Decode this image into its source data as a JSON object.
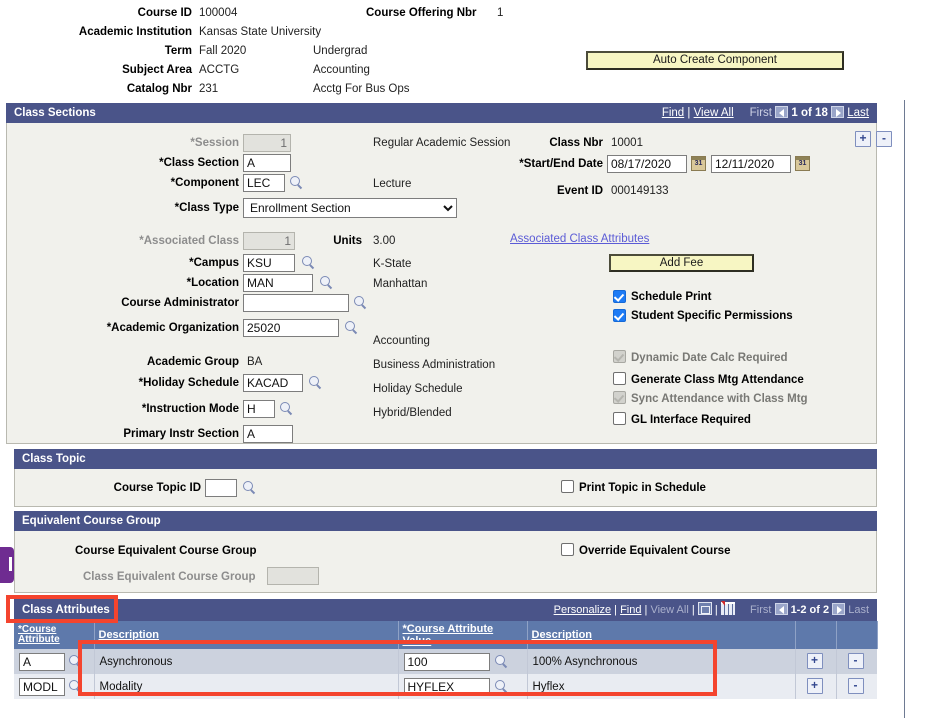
{
  "course_header": {
    "fields": [
      {
        "label": "Course ID",
        "value": "100004"
      },
      {
        "label": "Academic Institution",
        "value": "Kansas State University"
      },
      {
        "label": "Term",
        "value": "Fall 2020",
        "desc": "Undergrad"
      },
      {
        "label": "Subject Area",
        "value": "ACCTG",
        "desc": "Accounting"
      },
      {
        "label": "Catalog Nbr",
        "value": "231",
        "desc": "Acctg For Bus Ops"
      }
    ],
    "offering_label": "Course Offering Nbr",
    "offering_value": "1",
    "auto_create_button": "Auto Create Component"
  },
  "class_sections": {
    "title": "Class Sections",
    "nav": {
      "find": "Find",
      "sep": "|",
      "view_all": "View All",
      "first": "First",
      "counter": "1 of 18",
      "last": "Last"
    },
    "expand_button": "+",
    "collapse_button": "-",
    "session_label": "*Session",
    "session_value": "1",
    "session_desc": "Regular Academic Session",
    "class_section_label": "*Class Section",
    "class_section_value": "A",
    "component_label": "*Component",
    "component_value": "LEC",
    "component_desc": "Lecture",
    "class_type_label": "*Class Type",
    "class_type_value": "Enrollment Section",
    "class_nbr_label": "Class Nbr",
    "class_nbr_value": "10001",
    "start_end_label": "*Start/End Date",
    "start_date": "08/17/2020",
    "end_date": "12/11/2020",
    "event_id_label": "Event ID",
    "event_id_value": "000149133",
    "associated_class_label": "*Associated Class",
    "associated_class_value": "1",
    "units_label": "Units",
    "units_value": "3.00",
    "associated_class_attributes_link": "Associated Class Attributes",
    "campus_label": "*Campus",
    "campus_value": "KSU",
    "campus_desc": "K-State",
    "location_label": "*Location",
    "location_value": "MAN",
    "location_desc": "Manhattan",
    "course_admin_label": "Course Administrator",
    "course_admin_value": "",
    "academic_org_label": "*Academic Organization",
    "academic_org_value": "25020",
    "academic_org_desc": "Accounting",
    "academic_group_label": "Academic Group",
    "academic_group_value": "BA",
    "academic_group_desc": "Business Administration",
    "holiday_schedule_label": "*Holiday Schedule",
    "holiday_schedule_value": "KACAD",
    "holiday_schedule_desc": "Holiday Schedule",
    "instruction_mode_label": "*Instruction Mode",
    "instruction_mode_value": "H",
    "instruction_mode_desc": "Hybrid/Blended",
    "primary_instr_label": "Primary Instr Section",
    "primary_instr_value": "A",
    "add_fee_button": "Add Fee",
    "checkboxes": [
      {
        "label": "Schedule Print",
        "checked": true,
        "readonly": false
      },
      {
        "label": "Student Specific Permissions",
        "checked": true,
        "readonly": false
      },
      {
        "label": "Dynamic Date Calc Required",
        "checked": true,
        "readonly": true
      },
      {
        "label": "Generate Class Mtg Attendance",
        "checked": false,
        "readonly": false
      },
      {
        "label": "Sync Attendance with Class Mtg",
        "checked": true,
        "readonly": true
      },
      {
        "label": "GL Interface Required",
        "checked": false,
        "readonly": false
      }
    ]
  },
  "class_topic": {
    "title": "Class Topic",
    "course_topic_id_label": "Course Topic ID",
    "course_topic_id_value": "",
    "print_topic_label": "Print Topic in Schedule",
    "print_topic_checked": false
  },
  "equivalent_course_group": {
    "title": "Equivalent Course Group",
    "course_equiv_label": "Course Equivalent Course Group",
    "class_equiv_label": "Class Equivalent Course Group",
    "class_equiv_value": "",
    "override_label": "Override Equivalent Course",
    "override_checked": false
  },
  "class_attributes": {
    "title": "Class Attributes",
    "toolbar": {
      "personalize": "Personalize",
      "find": "Find",
      "view_all": "View All",
      "first": "First",
      "counter": "1-2 of 2",
      "last": "Last"
    },
    "columns": [
      "*Course Attribute",
      "Description",
      "*Course Attribute Value",
      "Description"
    ],
    "rows": [
      {
        "attribute": "A",
        "description": "Asynchronous",
        "value": "100",
        "value_description": "100% Asynchronous",
        "add": "+",
        "remove": "-"
      },
      {
        "attribute": "MODL",
        "description": "Modality",
        "value": "HYFLEX",
        "value_description": "Hyflex",
        "add": "+",
        "remove": "-"
      }
    ]
  },
  "colors": {
    "header_blue": "#4a5489",
    "column_blue": "#5e79ab",
    "button_yellow": "#f7f6c3",
    "annotation_red": "#f4442e",
    "panel_bg": "#f1f1ec",
    "purple_tab": "#6f2c91"
  }
}
